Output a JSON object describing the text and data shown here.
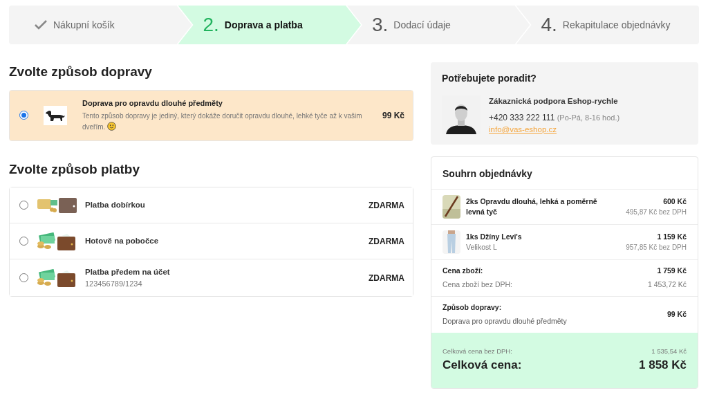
{
  "steps": [
    {
      "label": "Nákupní košík",
      "completed": true,
      "selected": false
    },
    {
      "number": "2.",
      "label": "Doprava a platba",
      "completed": false,
      "selected": true
    },
    {
      "number": "3.",
      "label": "Dodací údaje",
      "completed": false,
      "selected": false
    },
    {
      "number": "4.",
      "label": "Rekapitulace objednávky",
      "completed": false,
      "selected": false
    }
  ],
  "shipping": {
    "heading": "Zvolte způsob dopravy",
    "options": [
      {
        "name": "Doprava pro opravdu dlouhé předměty",
        "description": "Tento způsob dopravy je jediný, který dokáže doručit opravdu dlouhé, lehké tyče až k vašim dveřím.",
        "emoji": true,
        "price": "99 Kč",
        "selected": true
      }
    ]
  },
  "payment": {
    "heading": "Zvolte způsob platby",
    "options": [
      {
        "kind": "card",
        "name": "Platba dobírkou",
        "price": "ZDARMA",
        "selected": false
      },
      {
        "kind": "cash",
        "name": "Hotově na pobočce",
        "price": "ZDARMA",
        "selected": false
      },
      {
        "kind": "cash",
        "name": "Platba předem na účet",
        "detail": "123456789/1234",
        "price": "ZDARMA",
        "selected": false
      }
    ]
  },
  "help": {
    "heading": "Potřebujete poradit?",
    "name": "Zákaznická podpora Eshop-rychle",
    "phone": "+420 333 222 111",
    "hours": "(Po-Pá, 8-16 hod.)",
    "email": "info@vas-eshop.cz"
  },
  "summary": {
    "heading": "Souhrn objednávky",
    "items": [
      {
        "kind": "stick",
        "name": "2ks Opravdu dlouhá, lehká a poměrně levná tyč",
        "price": "600 Kč",
        "net": "495,87 Kč bez DPH"
      },
      {
        "kind": "jeans",
        "name": "1ks Džíny Levi's",
        "variant": "Velikost L",
        "price": "1 159 Kč",
        "net": "957,85 Kč bez DPH"
      }
    ],
    "goods_label": "Cena zboží:",
    "goods_price": "1 759 Kč",
    "goods_net_label": "Cena zboží bez DPH:",
    "goods_net": "1 453,72 Kč",
    "shipping_label": "Způsob dopravy:",
    "shipping_name": "Doprava pro opravdu dlouhé předměty",
    "shipping_price": "99 Kč",
    "total_net_label": "Celková cena bez DPH:",
    "total_net": "1 535,54 Kč",
    "total_label": "Celková cena:",
    "total": "1 858 Kč"
  }
}
